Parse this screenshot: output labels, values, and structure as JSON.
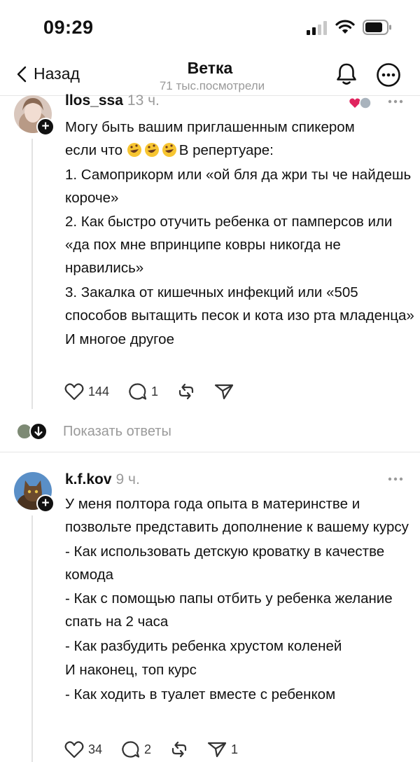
{
  "status_bar": {
    "time": "09:29"
  },
  "nav": {
    "back_label": "Назад",
    "title": "Ветка",
    "subtitle": "71 тыс.посмотрели"
  },
  "posts": [
    {
      "username": "llos_ssa",
      "time_ago": "13 ч.",
      "line1_before_emoji": "Могу быть вашим приглашенным спикером",
      "line2_before_emoji": "если что ",
      "emoji": "rolling-on-floor-laughing",
      "line2_after_emoji": "В репертуаре:",
      "paragraphs": [
        "1. Самоприкорм или «ой бля да жри ты че найдешь короче»",
        "2. Как быстро отучить ребенка от памперсов или «да пох мне впринципе ковры никогда не нравились»",
        "3. Закалка от кишечных инфекций или «505 способов вытащить песок и кота изо рта младенца»",
        "И многое другое"
      ],
      "likes": "144",
      "replies": "1",
      "reposts": "",
      "shares": ""
    },
    {
      "username": "k.f.kov",
      "time_ago": "9 ч.",
      "paragraphs": [
        "У меня полтора года опыта в материнстве и позвольте представить дополнение к вашему курсу",
        "- Как использовать детскую кроватку в качестве комода",
        "- Как с помощью папы отбить у ребенка желание спать на 2 часа",
        "- Как разбудить ребенка хрустом коленей",
        "И наконец, топ курс",
        "- Как ходить в туалет вместе с ребенком"
      ],
      "likes": "34",
      "replies": "2",
      "reposts": "",
      "shares": "1"
    }
  ],
  "show_replies_label": "Показать ответы",
  "colors": {
    "text": "#111111",
    "muted": "#9a9a9a",
    "divider": "#e6e6e6",
    "heart": "#e0245e"
  }
}
